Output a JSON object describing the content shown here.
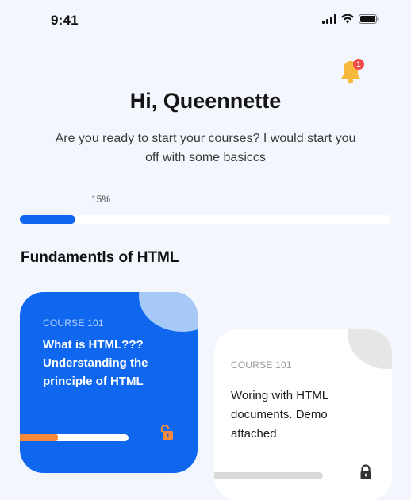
{
  "status_bar": {
    "time": "9:41",
    "icons": [
      "signal-icon",
      "wifi-icon",
      "battery-icon"
    ]
  },
  "notification": {
    "icon": "bell-icon",
    "badge_count": "1",
    "accent": "#f6b93b",
    "badge_color": "#ef4b4b"
  },
  "header": {
    "greeting": "Hi, Queennette",
    "intro": "Are you ready to start your courses? I would start you off with some basiccs"
  },
  "overall_progress": {
    "label": "15%",
    "fraction": 0.15,
    "color": "#0f67f0"
  },
  "section": {
    "title": "Fundamentls of HTML"
  },
  "courses": [
    {
      "code": "COURSE 101",
      "title": "What is HTML??? Understanding the principle of HTML",
      "progress_fraction": 0.35,
      "lock_state": "unlocked",
      "lock_icon": "unlocked-padlock-icon",
      "background": "#0f67f0"
    },
    {
      "code": "COURSE 101",
      "title": "Woring with HTML documents. Demo attached",
      "progress_fraction": 0,
      "lock_state": "locked",
      "lock_icon": "padlock-icon",
      "background": "#ffffff"
    }
  ]
}
